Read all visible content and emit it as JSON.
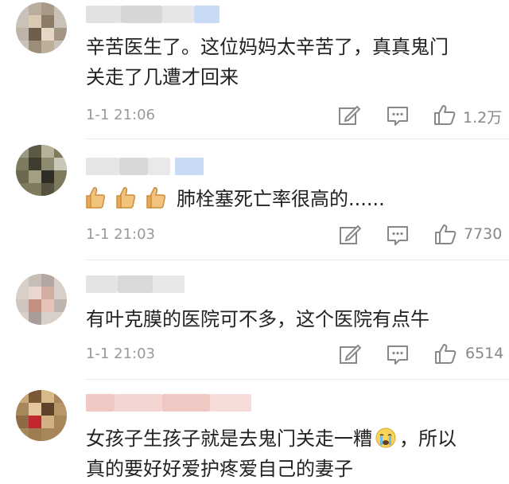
{
  "comments": [
    {
      "text_lines": [
        "辛苦医生了。这位妈妈太辛苦了，真真鬼门",
        "关走了几遭才回来"
      ],
      "time": "1-1 21:06",
      "likes": "1.2万"
    },
    {
      "text_lines": [
        "肺栓塞死亡率很高的......"
      ],
      "time": "1-1 21:03",
      "likes": "7730"
    },
    {
      "text_lines": [
        "有叶克膜的医院可不多，这个医院有点牛"
      ],
      "time": "1-1 21:03",
      "likes": "6514"
    },
    {
      "text_lines": [
        "女孩子生孩子就是去鬼门关走一糟",
        "，所以",
        "真的要好好爱护疼爱自己的妻子"
      ]
    }
  ],
  "icons": {
    "edit": "edit-icon",
    "reply": "comment-icon",
    "like": "thumbs-up-icon",
    "thumb_emoji": "thumbs-up-emoji",
    "crying_emoji": "crying-face-emoji"
  },
  "colors": {
    "text": "#222222",
    "meta": "#999999",
    "icon": "#888888",
    "divider": "#e8e8e8",
    "username_blur": "#dcdcdc",
    "vip_badge": "#c8daf6"
  }
}
